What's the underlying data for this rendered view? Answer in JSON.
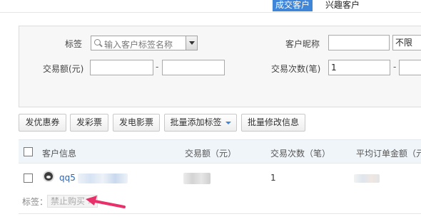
{
  "tabs": {
    "active": "成交客户",
    "inactive": "兴趣客户"
  },
  "filters": {
    "tag_label": "标签",
    "tag_placeholder": "输入客户标签名称",
    "nickname_label": "客户昵称",
    "nickname_value": "",
    "nickname_scope": "不限",
    "amount_label": "交易额(元)",
    "amount_from": "",
    "amount_to": "",
    "count_label": "交易次数(笔)",
    "count_from": "1",
    "count_to": "",
    "range_sep": "-"
  },
  "actions": {
    "coupon": "发优惠券",
    "lottery": "发彩票",
    "movie": "发电影票",
    "batch_tag": "批量添加标签",
    "batch_edit": "批量修改信息"
  },
  "table": {
    "headers": [
      "客户信息",
      "交易额（元）",
      "交易次数（笔）",
      "平均订单金额（元"
    ],
    "rows": [
      {
        "name": "qq5",
        "amount": "",
        "count": "1",
        "avg": "",
        "tag_label": "标签：",
        "tag": "禁止购买",
        "tag_remove": "×"
      }
    ]
  },
  "colors": {
    "accent": "#3f86d9",
    "link": "#2b63b4",
    "arrow": "#e8306a"
  },
  "icons": {
    "search": "search-icon",
    "dropdown": "chevron-down-icon",
    "avatar": "avatar",
    "arrow": "annotation-arrow"
  }
}
